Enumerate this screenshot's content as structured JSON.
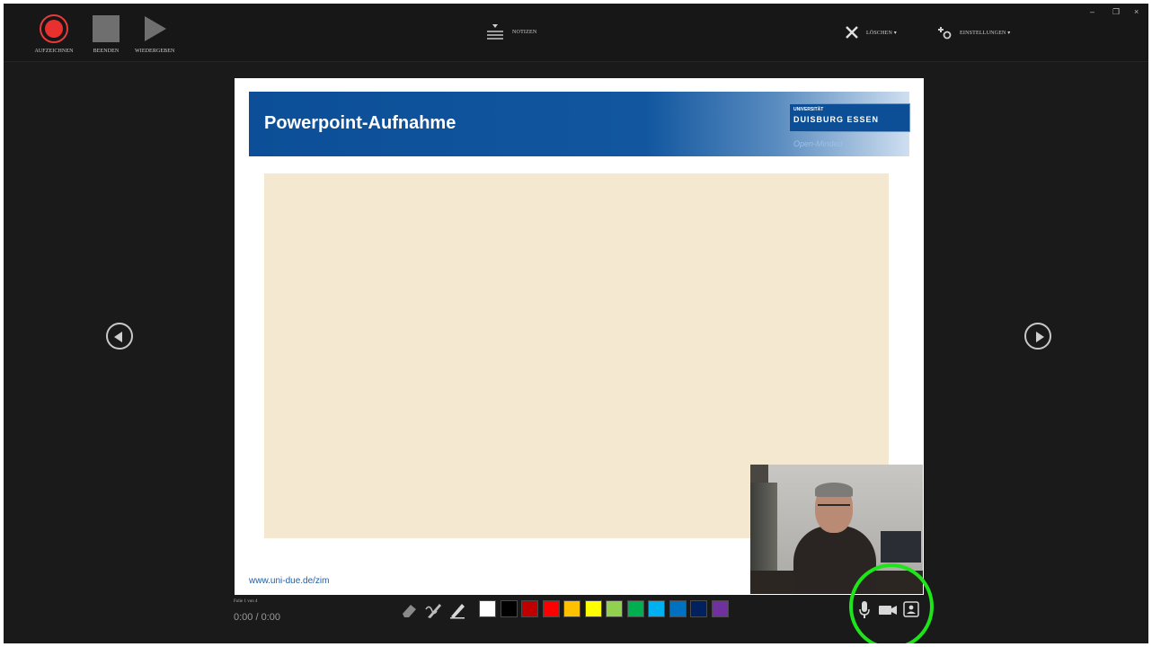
{
  "toolbar": {
    "record_label": "AUFZEICHNEN",
    "stop_label": "BEENDEN",
    "play_label": "WIEDERGEBEN",
    "notes_label": "NOTIZEN",
    "delete_label": "LÖSCHEN ▾",
    "settings_label": "EINSTELLUNGEN ▾"
  },
  "window_controls": {
    "minimize": "–",
    "restore": "❐",
    "close": "×"
  },
  "slide": {
    "title": "Powerpoint-Aufnahme",
    "logo_line1": "UNIVERSITÄT",
    "logo_line2": "DUISBURG ESSEN",
    "logo_motto": "Open-Minded",
    "footer_link": "www.uni-due.de/zim"
  },
  "status": {
    "slide_counter": "Folie 1 von 4",
    "timer": "0:00 / 0:00"
  },
  "pen_colors": [
    "#ffffff",
    "#000000",
    "#c00000",
    "#ff0000",
    "#ffc000",
    "#ffff00",
    "#92d050",
    "#00b050",
    "#00b0f0",
    "#0070c0",
    "#002060",
    "#7030a0"
  ],
  "accent": {
    "record": "#e8302e",
    "highlight": "#1ee51a"
  },
  "icons": {
    "record": "record-icon",
    "stop": "stop-icon",
    "play": "play-icon",
    "notes": "notes-icon",
    "delete": "close-icon",
    "settings": "settings-icon",
    "eraser": "eraser-icon",
    "pen": "pen-icon",
    "highlighter": "highlighter-icon",
    "microphone": "microphone-icon",
    "camera": "camera-icon",
    "camera_preview": "camera-preview-icon",
    "prev": "previous-slide-icon",
    "next": "next-slide-icon"
  }
}
